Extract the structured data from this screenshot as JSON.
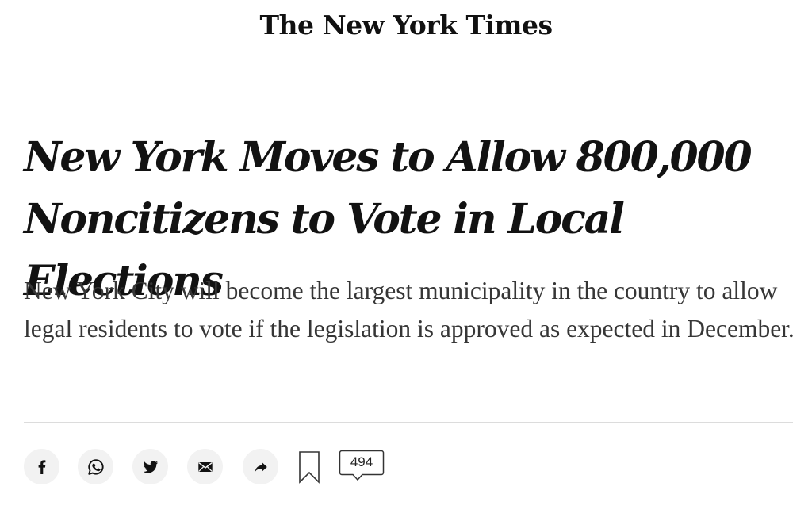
{
  "masthead": {
    "logo_text": "The New York Times"
  },
  "article": {
    "headline_line1": "New York Moves to Allow 800,000",
    "headline_line2": "Noncitizens to Vote in Local Elections",
    "summary": "New York City will become the largest municipality in the country to allow legal residents to vote if the legislation is approved as expected in December."
  },
  "share_bar": {
    "buttons": [
      {
        "icon": "facebook-icon"
      },
      {
        "icon": "whatsapp-icon"
      },
      {
        "icon": "twitter-icon"
      },
      {
        "icon": "email-icon"
      },
      {
        "icon": "share-arrow-icon"
      }
    ],
    "save_icon": "bookmark-icon",
    "comments_count": "494",
    "button_bg": "#f2f2f2",
    "icon_color": "#121212"
  }
}
